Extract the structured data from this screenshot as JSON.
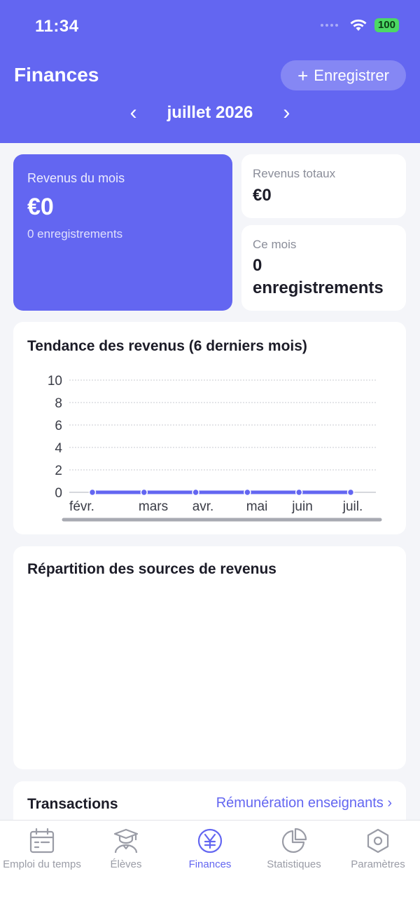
{
  "status_bar": {
    "time": "11:34",
    "battery": "100"
  },
  "header": {
    "title": "Finances",
    "record_label": "Enregistrer",
    "month": "juillet 2026",
    "prev_icon": "‹",
    "next_icon": "›"
  },
  "summary": {
    "monthly_label": "Revenus du mois",
    "monthly_value": "€0",
    "monthly_records": "0 enregistrements",
    "total_label": "Revenus totaux",
    "total_value": "€0",
    "this_month_label": "Ce mois",
    "this_month_value_line1": "0",
    "this_month_value_line2": "enregistrements"
  },
  "chart_data": {
    "type": "line",
    "title": "Tendance des revenus (6 derniers mois)",
    "categories": [
      "févr.",
      "mars",
      "avr.",
      "mai",
      "juin",
      "juil."
    ],
    "values": [
      0,
      0,
      0,
      0,
      0,
      0
    ],
    "ylim": [
      0,
      10
    ],
    "yticks": [
      0,
      2,
      4,
      6,
      8,
      10
    ],
    "grid": true,
    "color": "#6366f1"
  },
  "pie_section": {
    "title": "Répartition des sources de revenus"
  },
  "transactions": {
    "title": "Transactions",
    "link": "Rémunération enseignants ›"
  },
  "tabs": [
    {
      "label": "Emploi du temps",
      "icon": "calendar-icon"
    },
    {
      "label": "Élèves",
      "icon": "student-icon"
    },
    {
      "label": "Finances",
      "icon": "yen-icon"
    },
    {
      "label": "Statistiques",
      "icon": "pie-chart-icon"
    },
    {
      "label": "Paramètres",
      "icon": "settings-hexagon-icon"
    }
  ],
  "colors": {
    "accent": "#6366f1",
    "inactive": "#9a9ca6",
    "background": "#f4f5f9"
  }
}
